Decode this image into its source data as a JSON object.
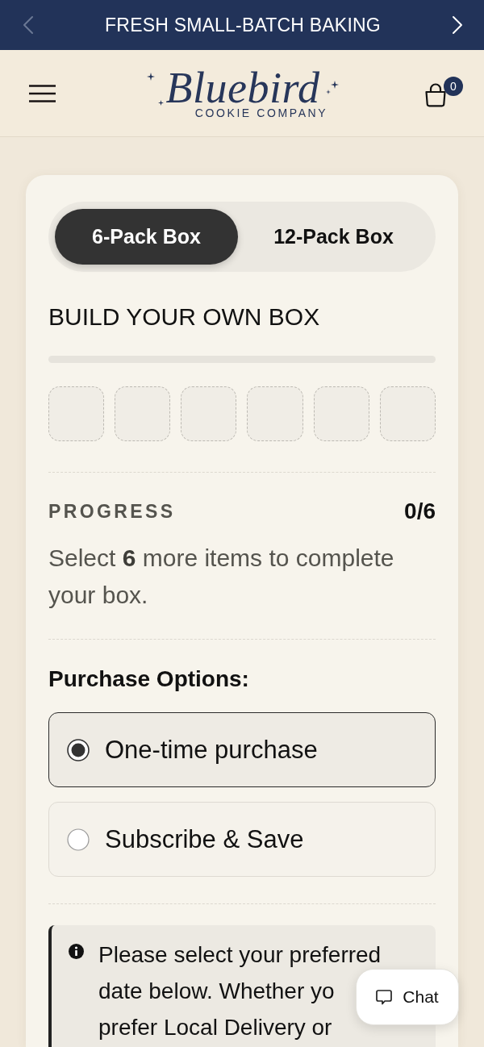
{
  "announcement_bar": {
    "message": "FRESH SMALL-BATCH BAKING",
    "arrows": [
      {
        "kind": "previous",
        "disabled": true
      },
      {
        "kind": "next",
        "disabled": false
      }
    ]
  },
  "header": {
    "logo": {
      "wordmark": "Bluebird",
      "tagline": "COOKIE COMPANY"
    },
    "cart_count": "0"
  },
  "box_builder": {
    "pack_tabs": [
      {
        "label": "6-Pack Box",
        "selected": true
      },
      {
        "label": "12-Pack Box",
        "selected": false
      }
    ],
    "title": "BUILD YOUR OWN BOX",
    "fill_bar": {
      "level": 0
    },
    "slots": [
      {
        "filled": false
      },
      {
        "filled": false
      },
      {
        "filled": false
      },
      {
        "filled": false
      },
      {
        "filled": false
      },
      {
        "filled": false
      }
    ],
    "progress": {
      "label": "PROGRESS",
      "count": "0/6",
      "message": "Select **6** more items to complete your box."
    }
  },
  "purchase_options": {
    "heading": "Purchase Options:",
    "options": [
      {
        "label": "One-time purchase",
        "selected": true
      },
      {
        "label": "Subscribe & Save",
        "selected": false
      }
    ]
  },
  "notice": {
    "lines": [
      "Please select your preferred",
      "date below. Whether yo",
      "prefer Local Delivery or"
    ]
  },
  "chat_button": {
    "label": "Chat"
  }
}
